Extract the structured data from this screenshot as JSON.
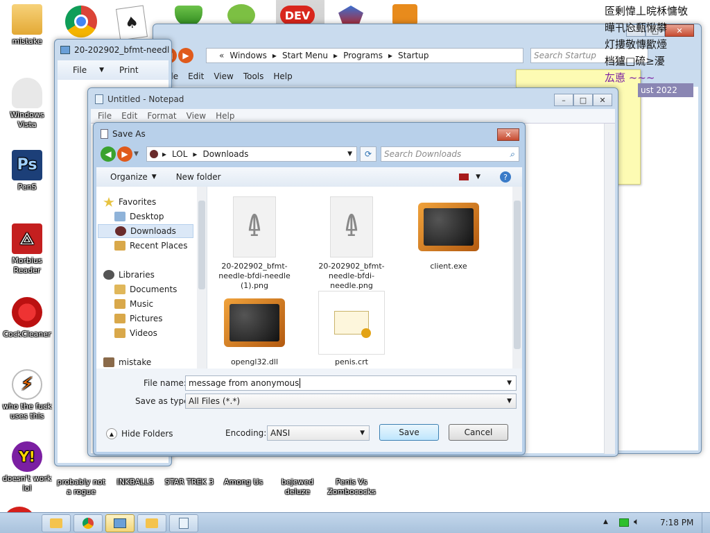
{
  "desktop": {
    "left_icons": [
      {
        "label": "mistake"
      },
      {
        "label": "Windows Vista"
      },
      {
        "label": "PenS"
      },
      {
        "label": "Morbius Reader"
      },
      {
        "label": "CockCleaner"
      },
      {
        "label": "who the fuck uses this"
      },
      {
        "label": "doesn't work lol"
      }
    ],
    "bottom_icons": [
      {
        "label": "probably not a rogue"
      },
      {
        "label": "INKBALLS"
      },
      {
        "label": "STAR TREK 3"
      },
      {
        "label": "Among Us"
      },
      {
        "label": "bejewed deluze"
      },
      {
        "label": "Penis Vs Zombococks"
      }
    ],
    "top_icon_dev_label": "DEV",
    "corner_text_lines": [
      "匼剰愇丄晥柇慵敂",
      "曄卂㤀甀愀攀",
      "灯摟敬慱歠㸀",
      "档獹□硫≥瀀",
      "厷悳 ~~~"
    ],
    "corner_date_fragment": "ust 2022"
  },
  "explorer_window": {
    "tab_title": "20-202902_bfmt-needl",
    "menu": [
      "File",
      "Print"
    ],
    "breadcrumb": [
      "«",
      "Windows",
      "Start Menu",
      "Programs",
      "Startup"
    ],
    "search_placeholder": "Search Startup",
    "menubar": [
      "File",
      "Edit",
      "View",
      "Tools",
      "Help"
    ]
  },
  "notepad": {
    "title": "Untitled - Notepad",
    "menu": [
      "File",
      "Edit",
      "Format",
      "View",
      "Help"
    ]
  },
  "save_as": {
    "title": "Save As",
    "breadcrumb": [
      "LOL",
      "Downloads"
    ],
    "search_placeholder": "Search Downloads",
    "toolbar": {
      "organize": "Organize",
      "new_folder": "New folder"
    },
    "nav": {
      "favorites": "Favorites",
      "desktop": "Desktop",
      "downloads": "Downloads",
      "recent": "Recent Places",
      "libraries": "Libraries",
      "documents": "Documents",
      "music": "Music",
      "pictures": "Pictures",
      "videos": "Videos",
      "mistake": "mistake"
    },
    "files": [
      {
        "name": "20-202902_bfmt-needle-bfdi-needle (1).png",
        "kind": "needle"
      },
      {
        "name": "20-202902_bfmt-needle-bfdi-needle.png",
        "kind": "needle"
      },
      {
        "name": "client.exe",
        "kind": "exe"
      },
      {
        "name": "opengl32.dll",
        "kind": "exe"
      },
      {
        "name": "penis.crt",
        "kind": "cert"
      }
    ],
    "file_name_label": "File name:",
    "file_name_value": "message from anonymous",
    "save_type_label": "Save as type:",
    "save_type_value": "All Files  (*.*)",
    "hide_folders": "Hide Folders",
    "encoding_label": "Encoding:",
    "encoding_value": "ANSI",
    "save_button": "Save",
    "cancel_button": "Cancel"
  },
  "taskbar": {
    "time": "7:18 PM"
  }
}
